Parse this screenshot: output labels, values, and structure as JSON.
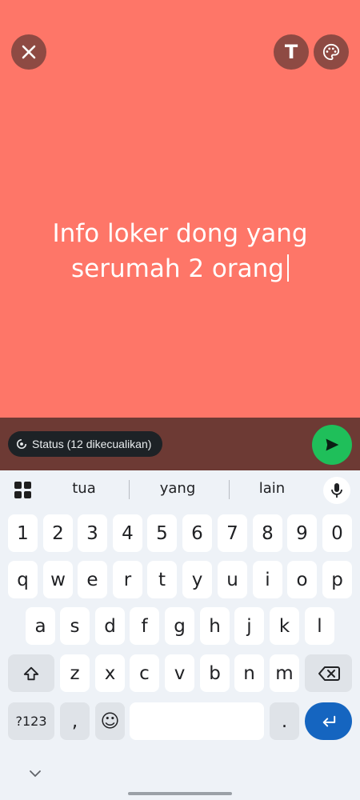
{
  "canvas": {
    "background_color": "#fe7668"
  },
  "top_controls": {
    "close_icon": "close-icon",
    "text_style_label": "T",
    "palette_icon": "palette-icon"
  },
  "status": {
    "text_line1": "Info loker dong yang",
    "text_line2": "serumah 2 orang"
  },
  "footer": {
    "audience_label": "Status (12 dikecualikan)",
    "send_icon": "send-icon",
    "accent_color": "#1fbf5a"
  },
  "keyboard": {
    "suggestions": [
      "tua",
      "yang",
      "lain"
    ],
    "number_row": [
      "1",
      "2",
      "3",
      "4",
      "5",
      "6",
      "7",
      "8",
      "9",
      "0"
    ],
    "row1": [
      "q",
      "w",
      "e",
      "r",
      "t",
      "y",
      "u",
      "i",
      "o",
      "p"
    ],
    "row2": [
      "a",
      "s",
      "d",
      "f",
      "g",
      "h",
      "j",
      "k",
      "l"
    ],
    "row3": [
      "z",
      "x",
      "c",
      "v",
      "b",
      "n",
      "m"
    ],
    "symbols_label": "?123",
    "comma_label": ",",
    "emoji_label": "☺",
    "period_label": ".",
    "enter_color": "#1565c0"
  }
}
